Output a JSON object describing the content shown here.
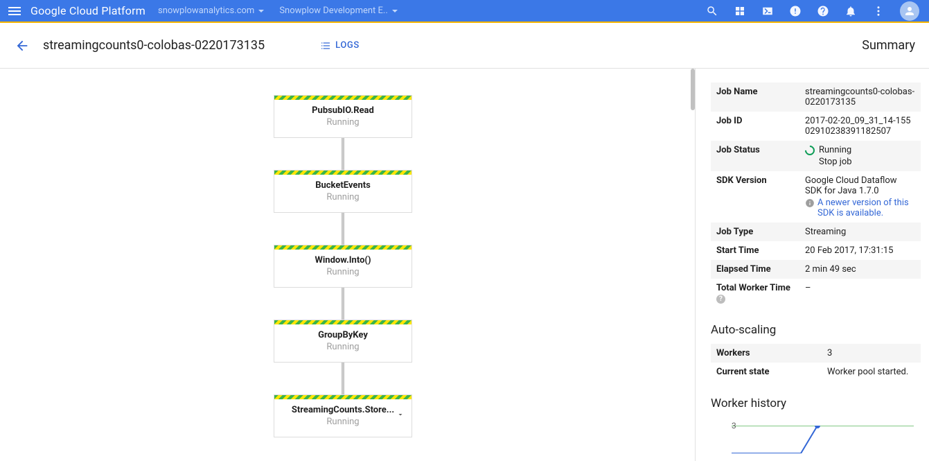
{
  "topbar": {
    "logo_text": "Google Cloud Platform",
    "org_selector": "snowplowanalytics.com",
    "project_selector": "Snowplow Development E.."
  },
  "subheader": {
    "job_title": "streamingcounts0-colobas-0220173135",
    "logs_label": "LOGS",
    "summary_label": "Summary"
  },
  "flow_nodes": [
    {
      "title": "PubsubIO.Read",
      "status": "Running",
      "expandable": false
    },
    {
      "title": "BucketEvents",
      "status": "Running",
      "expandable": false
    },
    {
      "title": "Window.Into()",
      "status": "Running",
      "expandable": false
    },
    {
      "title": "GroupByKey",
      "status": "Running",
      "expandable": false
    },
    {
      "title": "StreamingCounts.Store...",
      "status": "Running",
      "expandable": true
    }
  ],
  "summary": {
    "labels": {
      "job_name": "Job Name",
      "job_id": "Job ID",
      "job_status": "Job Status",
      "sdk_version": "SDK Version",
      "job_type": "Job Type",
      "start_time": "Start Time",
      "elapsed_time": "Elapsed Time",
      "total_worker_time": "Total Worker Time"
    },
    "values": {
      "job_name": "streamingcounts0-colobas-0220173135",
      "job_id": "2017-02-20_09_31_14-15502910238391182507",
      "job_status": "Running",
      "stop_job": "Stop job",
      "sdk_version": "Google Cloud Dataflow SDK for Java 1.7.0",
      "sdk_warning": "A newer version of this SDK is available.",
      "job_type": "Streaming",
      "start_time": "20 Feb 2017, 17:31:15",
      "elapsed_time": "2 min 49 sec",
      "total_worker_time": "–"
    }
  },
  "autoscaling": {
    "title": "Auto-scaling",
    "labels": {
      "workers": "Workers",
      "current_state": "Current state"
    },
    "values": {
      "workers": "3",
      "current_state": "Worker pool started."
    }
  },
  "worker_history": {
    "title": "Worker history",
    "y_tick": "3"
  }
}
